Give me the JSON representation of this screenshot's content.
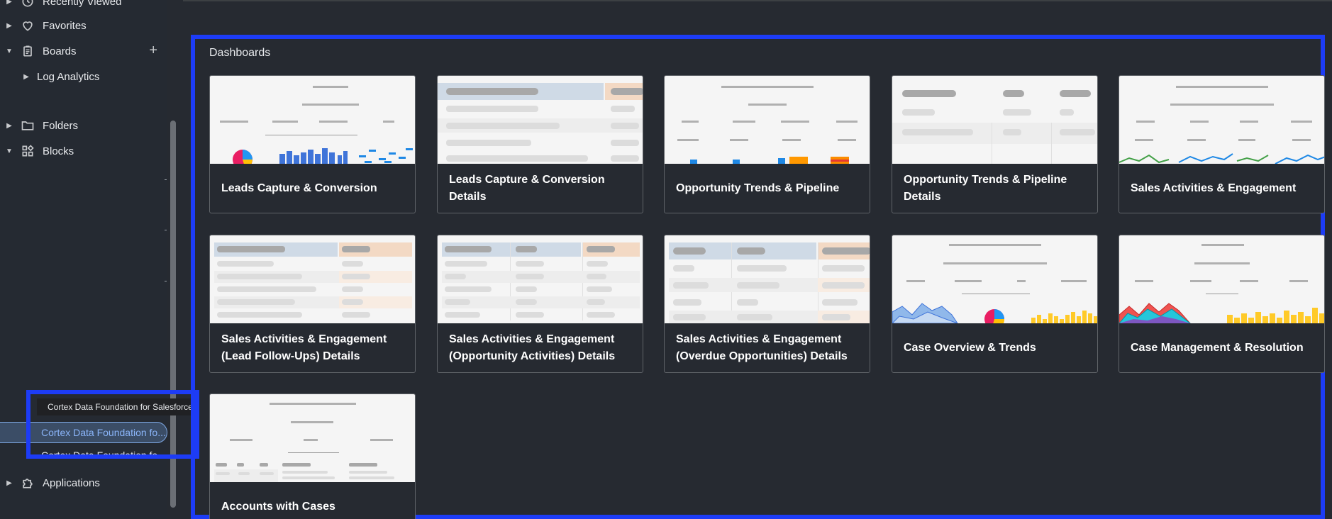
{
  "sidebar": {
    "items": [
      {
        "label": "Recently Viewed",
        "icon": "clock-icon"
      },
      {
        "label": "Favorites",
        "icon": "heart-icon"
      },
      {
        "label": "Boards",
        "icon": "clipboard-icon"
      },
      {
        "label": "Log Analytics"
      },
      {
        "label": "Folders",
        "icon": "folder-icon"
      },
      {
        "label": "Blocks",
        "icon": "blocks-icon"
      },
      {
        "label": "Applications",
        "icon": "puzzle-icon"
      }
    ],
    "tooltip": "Cortex Data Foundation for Salesforce",
    "selected_item": "Cortex Data Foundation fo...",
    "next_item": "Cortex Data Foundation fo..."
  },
  "main": {
    "title": "Dashboards",
    "cards": [
      {
        "label": "Leads Capture & Conversion",
        "thumb": "chart"
      },
      {
        "label": "Leads Capture & Conversion Details",
        "thumb": "table"
      },
      {
        "label": "Opportunity Trends & Pipeline",
        "thumb": "chart"
      },
      {
        "label": "Opportunity Trends & Pipeline Details",
        "thumb": "table"
      },
      {
        "label": "Sales Activities & Engagement",
        "thumb": "chart"
      },
      {
        "label": "Sales Activities & Engagement (Lead Follow-Ups) Details",
        "thumb": "table"
      },
      {
        "label": "Sales Activities & Engagement (Opportunity Activities) Details",
        "thumb": "table"
      },
      {
        "label": "Sales Activities & Engagement (Overdue Opportunities) Details",
        "thumb": "table"
      },
      {
        "label": "Case Overview & Trends",
        "thumb": "chart"
      },
      {
        "label": "Case Management & Resolution",
        "thumb": "chart"
      },
      {
        "label": "Accounts with Cases",
        "thumb": "chart"
      }
    ]
  },
  "colors": {
    "highlight": "#1d3cf6",
    "selected_text": "#8ab4f8"
  }
}
